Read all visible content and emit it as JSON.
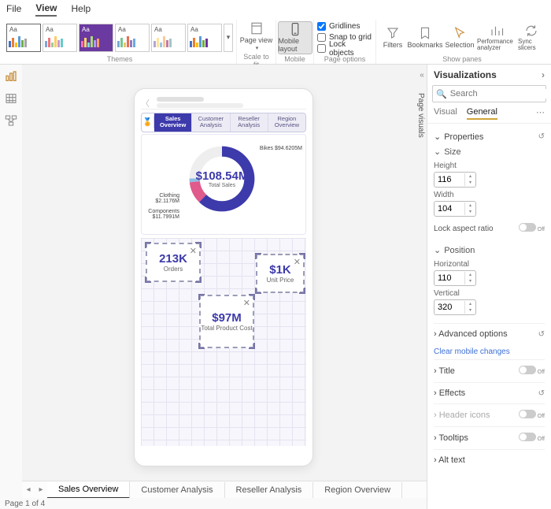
{
  "menu": {
    "file": "File",
    "view": "View",
    "help": "Help",
    "active": "View"
  },
  "ribbon": {
    "theme_label": "Aa",
    "themes_group": "Themes",
    "page_view": "Page view",
    "scale_to_fit": "Scale to fit",
    "mobile_layout": "Mobile layout",
    "mobile_group": "Mobile",
    "gridlines": "Gridlines",
    "snap_to_grid": "Snap to grid",
    "lock_objects": "Lock objects",
    "page_options": "Page options",
    "filters": "Filters",
    "bookmarks": "Bookmarks",
    "selection": "Selection",
    "perf": "Performance analyzer",
    "sync": "Sync slicers",
    "show_panes": "Show panes"
  },
  "side_label": "Page visuals",
  "phone": {
    "tabs": [
      "Sales Overview",
      "Customer Analysis",
      "Reseller Analysis",
      "Region Overview"
    ],
    "total_sales_value": "$108.54M",
    "total_sales_label": "Total Sales",
    "lbl_bikes": "Bikes $94.6205M",
    "lbl_clothing": "Clothing $2.1176M",
    "lbl_components": "Components $11.7991M",
    "cards": {
      "orders_v": "213K",
      "orders_l": "Orders",
      "unitprice_v": "$1K",
      "unitprice_l": "Unit Price",
      "tpc_v": "$97M",
      "tpc_l": "Total Product Cost"
    }
  },
  "page_tabs": [
    "Sales Overview",
    "Customer Analysis",
    "Reseller Analysis",
    "Region Overview"
  ],
  "status": "Page 1 of 4",
  "pane": {
    "title": "Visualizations",
    "search_ph": "Search",
    "tab_visual": "Visual",
    "tab_general": "General",
    "properties": "Properties",
    "size": "Size",
    "height": "Height",
    "height_v": "116",
    "width": "Width",
    "width_v": "104",
    "lock_ar": "Lock aspect ratio",
    "position": "Position",
    "horizontal": "Horizontal",
    "horizontal_v": "110",
    "vertical": "Vertical",
    "vertical_v": "320",
    "advanced": "Advanced options",
    "clear_mobile": "Clear mobile changes",
    "title_r": "Title",
    "effects": "Effects",
    "header_icons": "Header icons",
    "tooltips": "Tooltips",
    "alt_text": "Alt text",
    "toggle_off": "Off"
  },
  "chart_data": {
    "type": "pie",
    "title": "Total Sales",
    "total": 108.54,
    "unit": "M USD",
    "series": [
      {
        "name": "Bikes",
        "value": 94.6205
      },
      {
        "name": "Components",
        "value": 11.7991
      },
      {
        "name": "Clothing",
        "value": 2.1176
      }
    ]
  }
}
